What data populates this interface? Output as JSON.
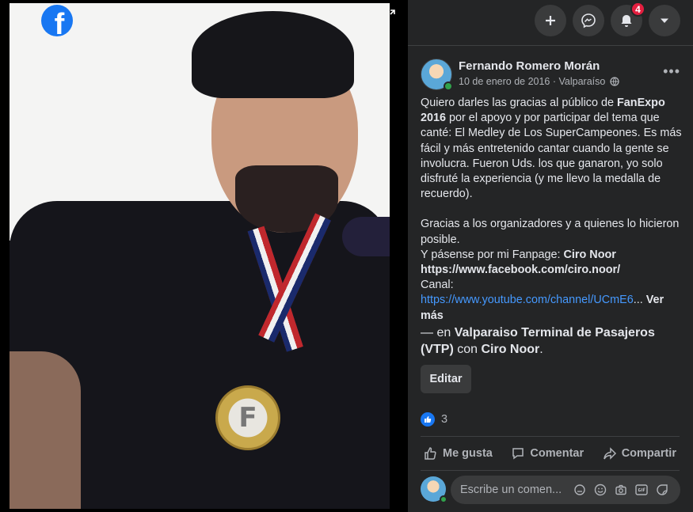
{
  "viewer": {
    "medal_letter": "F"
  },
  "topbar": {
    "notifications_count": "4"
  },
  "post": {
    "author": "Fernando Romero Morán",
    "date": "10 de enero de 2016",
    "location": "Valparaíso",
    "separator": " · ",
    "body": {
      "p1_a": "Quiero darles las gracias al público de ",
      "p1_b": "FanExpo 2016",
      "p1_c": " por el apoyo y por participar del tema que canté: El Medley de Los SuperCampeones. Es más fácil y más entretenido cantar cuando la gente se involucra. Fueron Uds. los que ganaron, yo solo disfruté la experiencia (y me llevo la medalla de recuerdo).",
      "p2": "Gracias a los organizadores y a quienes lo hicieron posible.",
      "p3_a": "Y pásense por mi Fanpage: ",
      "p3_b": "Ciro Noor",
      "p3_url": "https://www.facebook.com/ciro.noor/",
      "p4_label": "Canal:",
      "p4_url": "https://www.youtube.com/channel/UCmE6",
      "ellipsis": "...",
      "see_more": " Ver más"
    },
    "tag": {
      "prefix": "— en ",
      "place": "Valparaiso Terminal de Pasajeros (VTP)",
      "with": " con ",
      "person": "Ciro Noor",
      "end": "."
    },
    "edit_label": "Editar",
    "reaction_count": "3",
    "actions": {
      "like": "Me gusta",
      "comment": "Comentar",
      "share": "Compartir"
    },
    "comment_placeholder": "Escribe un comen..."
  }
}
